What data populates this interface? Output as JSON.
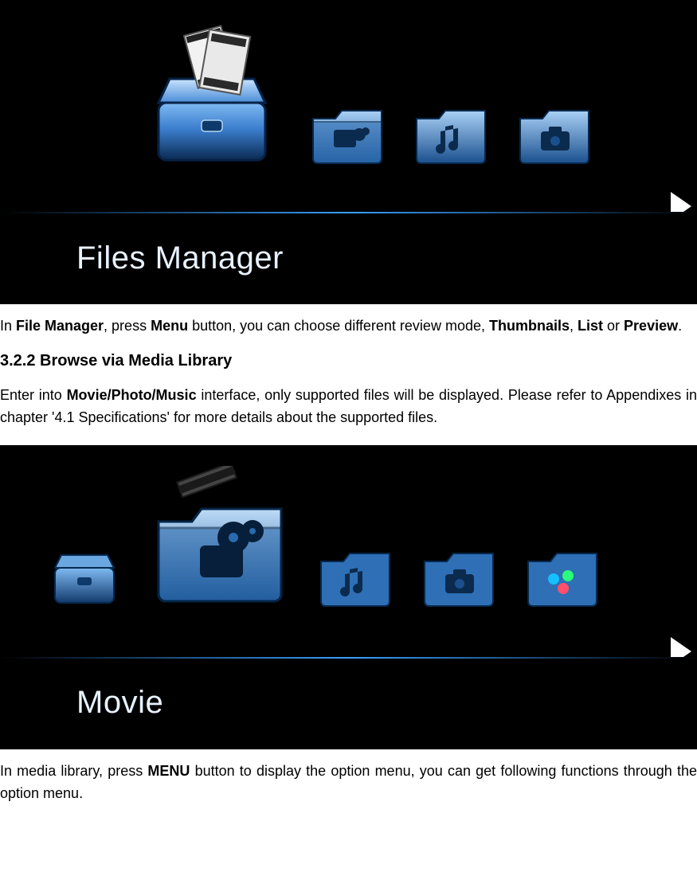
{
  "screenshot1": {
    "caption": "Files Manager"
  },
  "para1": {
    "t1": "In ",
    "b1": "File Manager",
    "t2": ", press ",
    "b2": "Menu",
    "t3": " button, you can choose different review mode, ",
    "b3": "Thumbnails",
    "t4": ", ",
    "b4": "List",
    "t5": " or ",
    "b5": "Preview",
    "t6": "."
  },
  "heading": "3.2.2 Browse via Media Library",
  "para2": {
    "t1": "Enter into ",
    "b1": "Movie/Photo/Music",
    "t2": " interface, only supported files will be displayed. Please refer to Appendixes in chapter '4.1 Specifications' for more details about the supported files."
  },
  "screenshot2": {
    "caption": "Movie"
  },
  "para3": {
    "t1": "In media library, press ",
    "b1": "MENU",
    "t2": " button to display the option menu, you can get following functions through the option menu."
  }
}
